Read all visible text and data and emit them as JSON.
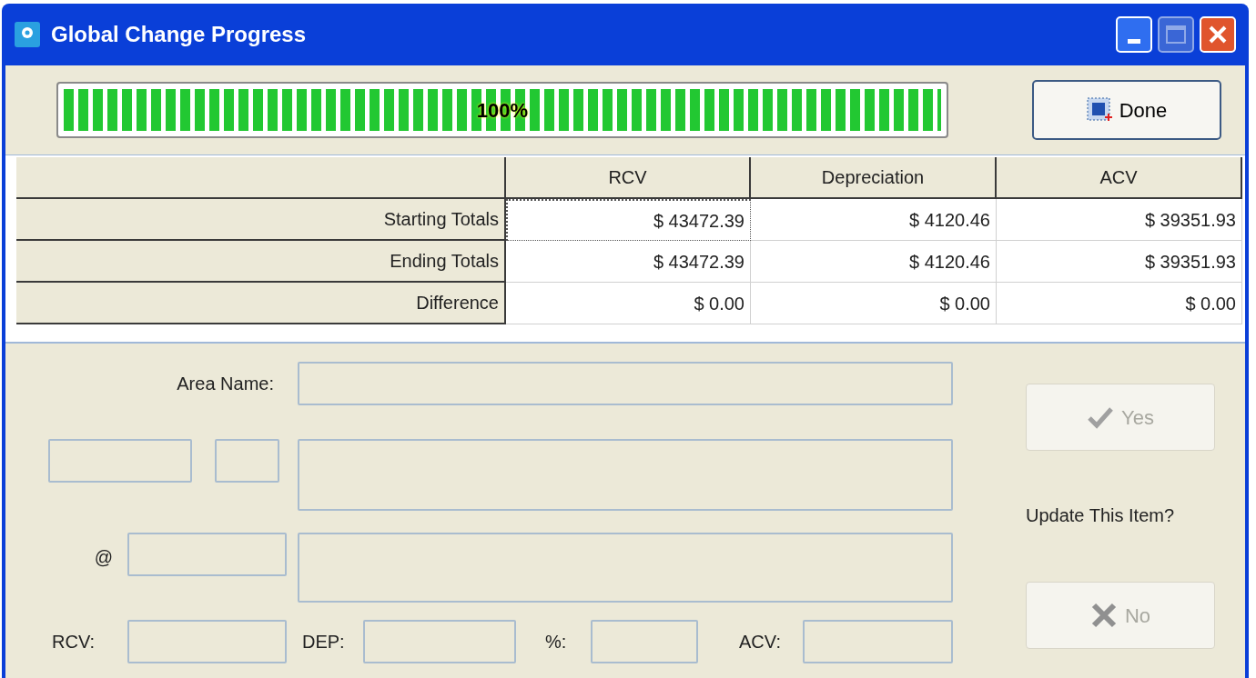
{
  "window": {
    "title": "Global Change Progress"
  },
  "progress": {
    "level": 1,
    "label": "100%"
  },
  "done_button": {
    "label": "Done"
  },
  "table": {
    "columns": [
      "RCV",
      "Depreciation",
      "ACV"
    ],
    "rows": [
      {
        "label": "Starting Totals",
        "cells": [
          {
            "text": "$ 43472.39",
            "focused": true
          },
          {
            "text": "$ 4120.46",
            "focused": false
          },
          {
            "text": "$ 39351.93",
            "focused": false
          }
        ]
      },
      {
        "label": "Ending Totals",
        "cells": [
          {
            "text": "$ 43472.39",
            "focused": false
          },
          {
            "text": "$ 4120.46",
            "focused": false
          },
          {
            "text": "$ 39351.93",
            "focused": false
          }
        ]
      },
      {
        "label": "Difference",
        "cells": [
          {
            "text": "$ 0.00",
            "focused": false
          },
          {
            "text": "$ 0.00",
            "focused": false
          },
          {
            "text": "$ 0.00",
            "focused": false
          }
        ]
      }
    ]
  },
  "form": {
    "area_name_label": "Area Name:",
    "at_label": "@",
    "rcv_label": "RCV:",
    "dep_label": "DEP:",
    "percent_label": "%:",
    "acv_label": "ACV:"
  },
  "yes_button": {
    "label": "Yes",
    "disabled": true
  },
  "prompt": "Update This Item?",
  "no_button": {
    "label": "No",
    "disabled": true
  }
}
